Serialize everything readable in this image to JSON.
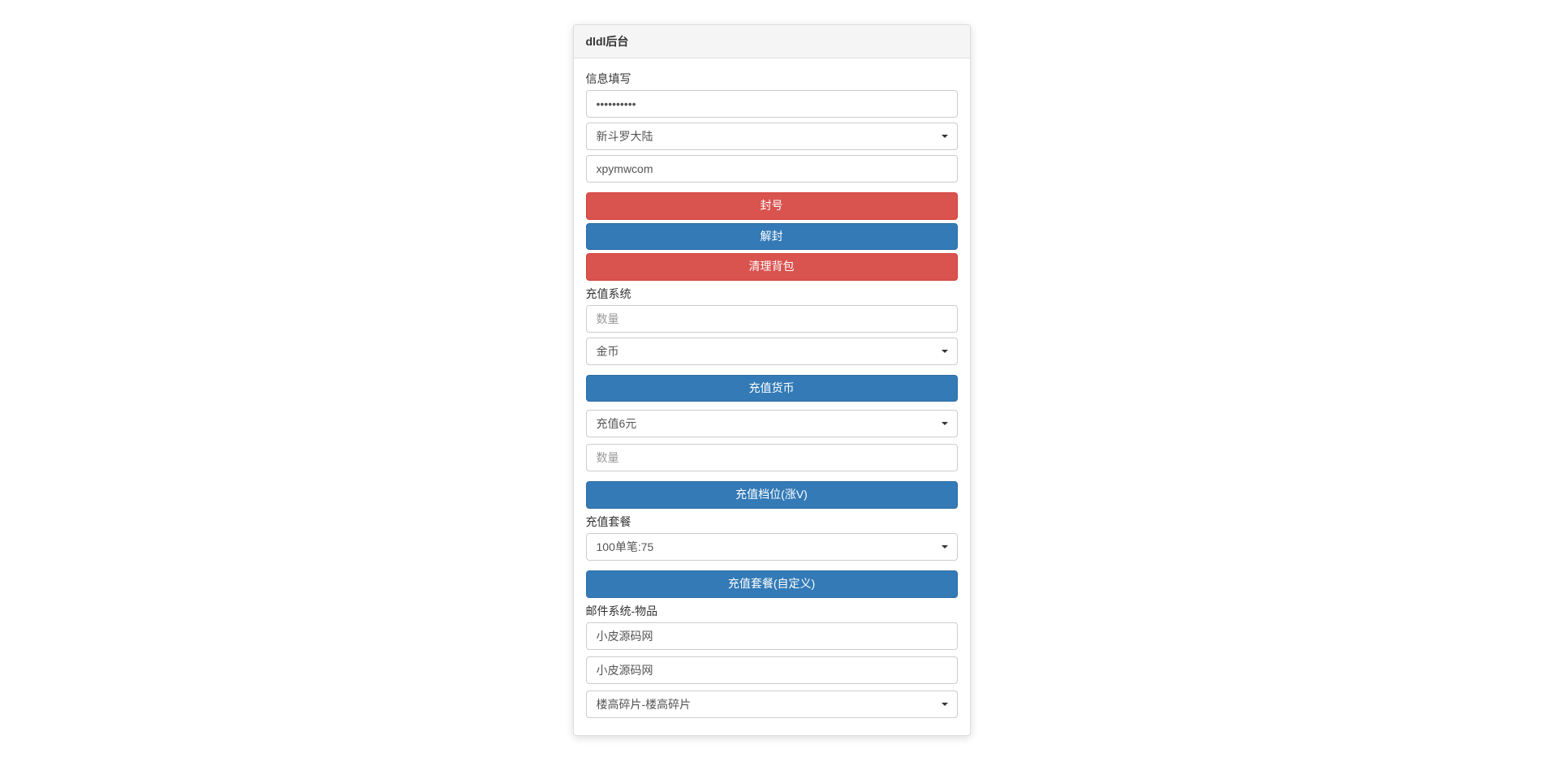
{
  "panel": {
    "title": "dldl后台"
  },
  "info": {
    "section_label": "信息填写",
    "password_value": "••••••••••",
    "server_select": "新斗罗大陆",
    "account_value": "xpymwcom",
    "ban_button": "封号",
    "unban_button": "解封",
    "clear_bag_button": "清理背包"
  },
  "recharge": {
    "section_label": "充值系统",
    "quantity_placeholder": "数量",
    "currency_select": "金币",
    "recharge_currency_button": "充值货币",
    "tier_select": "充值6元",
    "quantity2_placeholder": "数量",
    "recharge_tier_button": "充值档位(涨V)"
  },
  "package": {
    "section_label": "充值套餐",
    "package_select": "100单笔:75",
    "recharge_package_button": "充值套餐(自定义)"
  },
  "mail": {
    "section_label": "邮件系统-物品",
    "field1_value": "小皮源码网",
    "field2_value": "小皮源码网",
    "item_select": "楼高碎片-楼高碎片"
  }
}
